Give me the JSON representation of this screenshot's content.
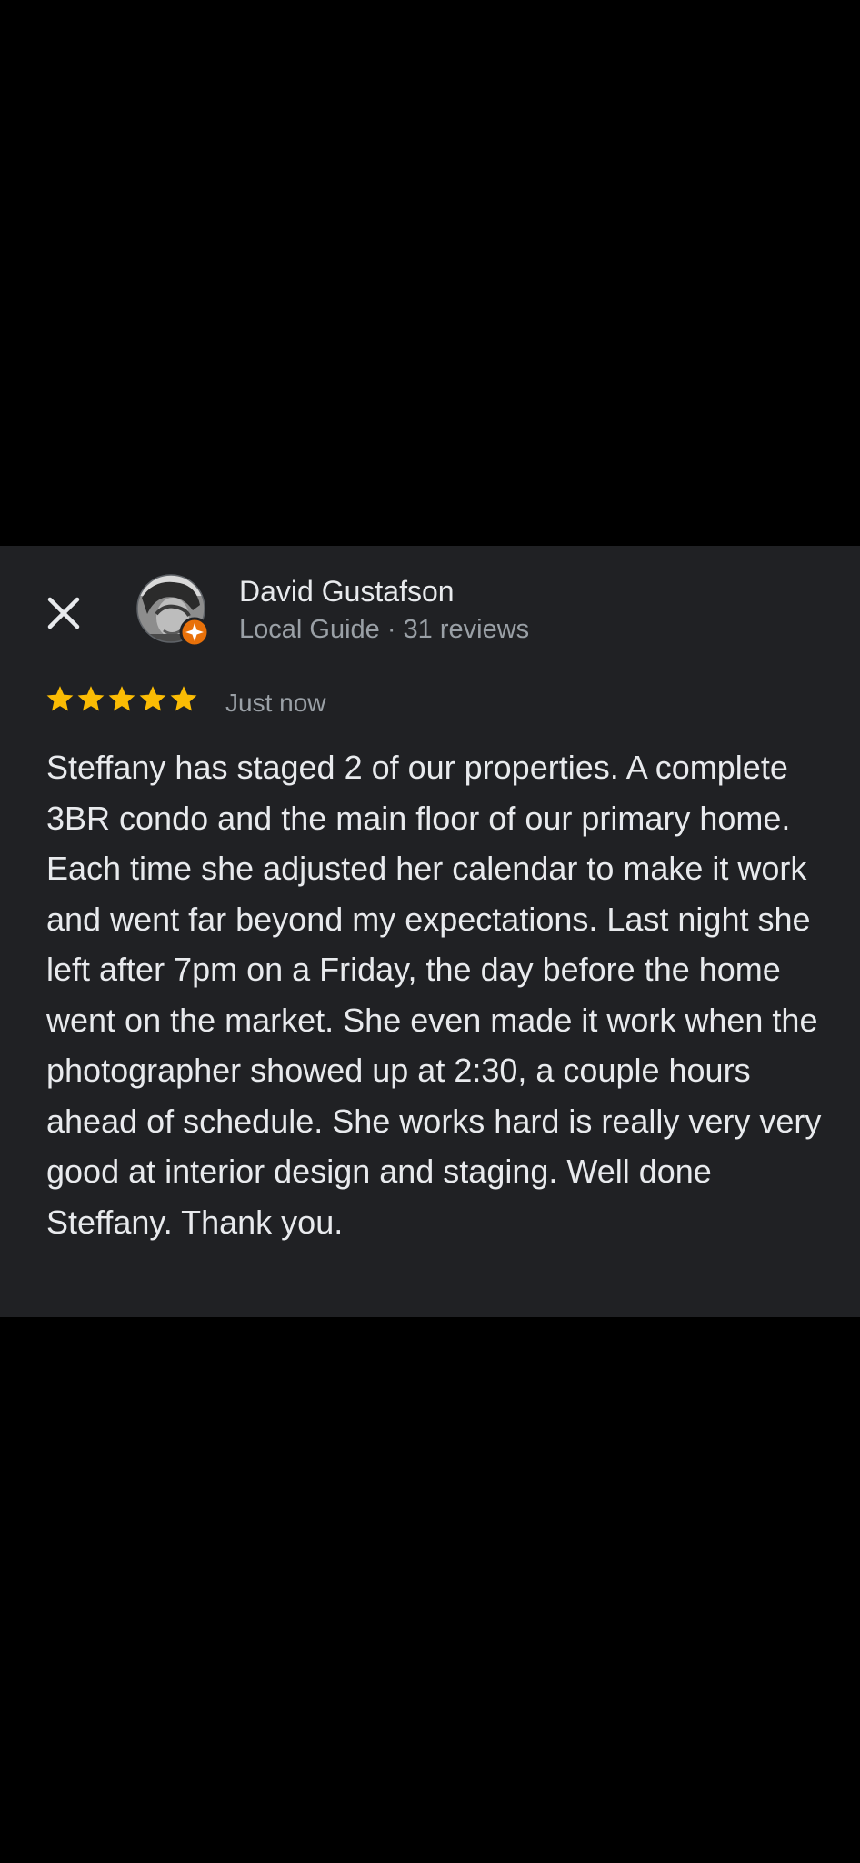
{
  "review": {
    "reviewer_name": "David Gustafson",
    "reviewer_meta": "Local Guide · 31 reviews",
    "rating": 5,
    "rating_max": 5,
    "time": "Just now",
    "text": "Steffany has staged 2 of our properties. A complete 3BR condo and the main floor of our primary home. Each time she adjusted her calendar to make it work and went far beyond my expectations. Last night she left after 7pm on a Friday, the day before the home went on the market. She even made it work when the photographer showed up at 2:30, a couple hours ahead of schedule. She works hard is really very very good at interior design and staging. Well done Steffany. Thank you."
  },
  "icons": {
    "close": "close-icon",
    "avatar": "avatar",
    "local_guide_badge": "local-guide-badge-icon",
    "star": "star-icon"
  },
  "colors": {
    "background": "#000000",
    "card": "#202124",
    "primary_text": "#e8eaed",
    "secondary_text": "#9aa0a6",
    "star": "#fbbc04",
    "badge": "#e8710a"
  }
}
